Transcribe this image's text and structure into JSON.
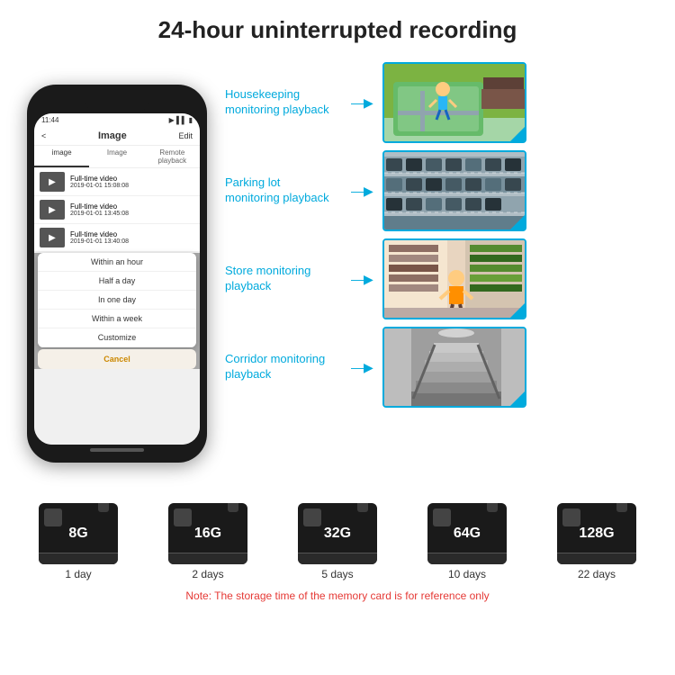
{
  "header": {
    "title": "24-hour uninterrupted recording"
  },
  "phone": {
    "time": "11:44",
    "screen_title": "Image",
    "edit_label": "Edit",
    "back_label": "<",
    "tabs": [
      "image",
      "Image",
      "Remote playback"
    ],
    "video_items": [
      {
        "label": "Full-time video",
        "date": "2019-01-01 15:08:08"
      },
      {
        "label": "Full-time video",
        "date": "2019-01-01 13:45:08"
      },
      {
        "label": "Full-time video",
        "date": "2019-01-01 13:40:08"
      }
    ],
    "dropdown_items": [
      "Within an hour",
      "Half a day",
      "In one day",
      "Within a week",
      "Customize"
    ],
    "cancel_label": "Cancel"
  },
  "monitoring": [
    {
      "label": "Housekeeping\nmonitoring playback",
      "img_class": "img-housekeeping"
    },
    {
      "label": "Parking lot\nmonitoring playback",
      "img_class": "img-parking"
    },
    {
      "label": "Store monitoring\nplayback",
      "img_class": "img-store"
    },
    {
      "label": "Corridor monitoring\nplayback",
      "img_class": "img-corridor"
    }
  ],
  "storage": {
    "cards": [
      {
        "size": "8G",
        "days": "1 day"
      },
      {
        "size": "16G",
        "days": "2 days"
      },
      {
        "size": "32G",
        "days": "5 days"
      },
      {
        "size": "64G",
        "days": "10 days"
      },
      {
        "size": "128G",
        "days": "22 days"
      }
    ],
    "note": "Note: The storage time of the memory card is for reference only"
  }
}
